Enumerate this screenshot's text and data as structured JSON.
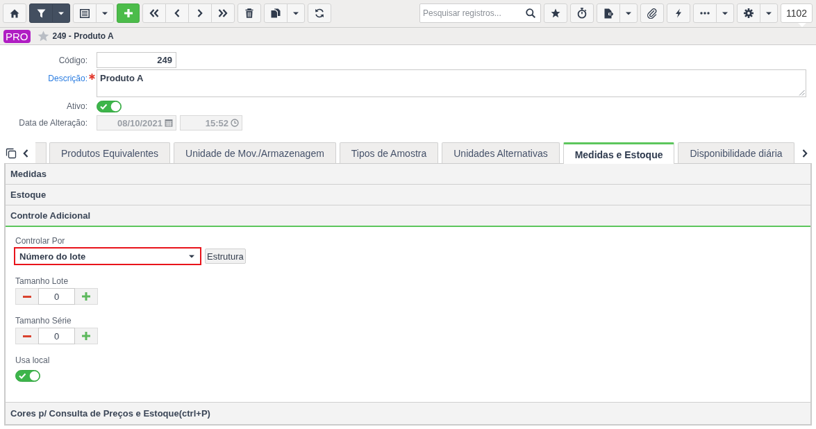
{
  "toolbar": {
    "filter": {
      "active": true
    },
    "search": {
      "placeholder": "Pesquisar registros..."
    },
    "record_count": "1102"
  },
  "header": {
    "badge": "PRO",
    "favorite": false,
    "title": "249 - Produto A"
  },
  "form": {
    "fields": [
      {
        "kind": "text",
        "label": "Código:",
        "value": "249",
        "required": false,
        "disabled": false
      },
      {
        "kind": "textarea",
        "label": "Descrição:",
        "value": "Produto A",
        "required": true,
        "disabled": false
      },
      {
        "kind": "toggle",
        "label": "Ativo:",
        "on": true,
        "required": false,
        "disabled": false
      },
      {
        "kind": "datetime",
        "label": "Data de Alteração:",
        "date": "08/10/2021",
        "time": "15:52",
        "required": false,
        "disabled": true
      }
    ]
  },
  "tabs": [
    {
      "label": "Produtos Equivalentes",
      "selected": false
    },
    {
      "label": "Unidade de Mov./Armazenagem",
      "selected": false
    },
    {
      "label": "Tipos de Amostra",
      "selected": false
    },
    {
      "label": "Unidades Alternativas",
      "selected": false
    },
    {
      "label": "Medidas e Estoque",
      "selected": true
    },
    {
      "label": "Disponibilidade diária",
      "selected": false
    }
  ],
  "sections": [
    {
      "title": "Medidas",
      "expanded": false
    },
    {
      "title": "Estoque",
      "expanded": false
    },
    {
      "title": "Controle Adicional",
      "expanded": true,
      "fields": [
        {
          "kind": "select",
          "label": "Controlar Por",
          "value": "Número do lote",
          "highlighted": true,
          "button": "Estrutura"
        },
        {
          "kind": "spinner",
          "label": "Tamanho Lote",
          "value": "0"
        },
        {
          "kind": "spinner",
          "label": "Tamanho Série",
          "value": "0"
        },
        {
          "kind": "toggle",
          "label": "Usa local",
          "on": true
        }
      ]
    },
    {
      "title": "Cores p/ Consulta de Preços e Estoque(ctrl+P)",
      "expanded": false
    }
  ]
}
